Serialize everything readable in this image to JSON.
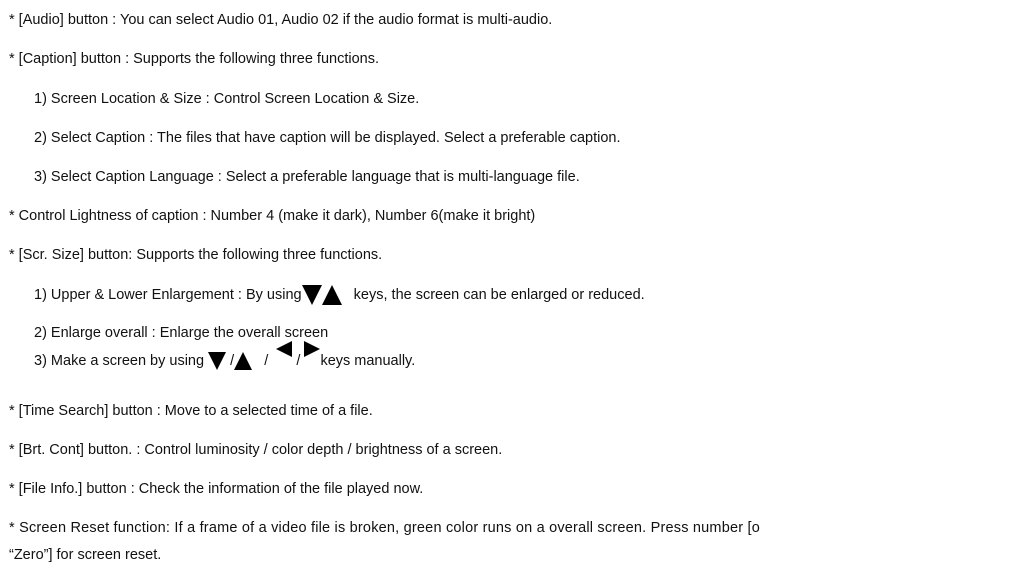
{
  "lines": {
    "audio": "* [Audio] button : You can select Audio 01, Audio 02 if the audio format is multi-audio.",
    "caption": "* [Caption] button : Supports the following three functions.",
    "caption_1": "1) Screen Location & Size : Control Screen Location & Size.",
    "caption_2": "2) Select Caption : The files that have caption will be displayed. Select a preferable caption.",
    "caption_3": "3) Select Caption Language : Select a preferable language that is multi-language file.",
    "lightness": "* Control Lightness of caption : Number 4 (make it dark), Number 6(make it bright)",
    "scr_size": "* [Scr. Size] button: Supports the following three functions.",
    "scr_1_a": "1) Upper & Lower Enlargement : By using",
    "scr_1_b": "keys, the screen can be enlarged or reduced.",
    "scr_2": "2) Enlarge overall : Enlarge the overall screen",
    "scr_3_a": "3) Make a screen by using",
    "scr_3_sep1": "/",
    "scr_3_sep2": "/",
    "scr_3_sep3": "/",
    "scr_3_b": "keys manually.",
    "time_search": "* [Time Search] button : Move to a selected time of a file.",
    "brt_cont": "* [Brt. Cont] button. : Control luminosity / color depth / brightness of a screen.",
    "file_info": "* [File Info.] button : Check the information of the file played now.",
    "reset_1": "* Screen Reset  function: If a frame of a video file is broken, green color runs on a overall screen. Press number [o",
    "reset_2": "“Zero”] for screen reset."
  },
  "icons": [
    "arrow-down-icon",
    "arrow-up-icon",
    "arrow-left-icon",
    "arrow-right-icon"
  ]
}
